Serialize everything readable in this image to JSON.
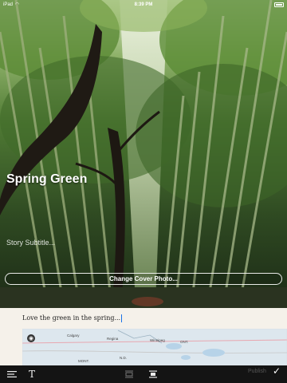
{
  "status_bar": {
    "carrier": "iPad",
    "time": "8:39 PM"
  },
  "story": {
    "title": "Spring Green",
    "subtitle_placeholder": "Story Subtitle...",
    "change_cover_label": "Change Cover Photo...",
    "body_text": "Love the green in the spring..."
  },
  "map": {
    "labels": [
      "Calgary",
      "Regina",
      "Winnipeg",
      "ONT.",
      "MONT.",
      "N.D."
    ]
  },
  "toolbar": {
    "text_label": "T",
    "publish_label": "Publish",
    "check_label": "✓"
  },
  "colors": {
    "toolbar_bg": "#141414",
    "editor_bg": "#f5f1ea",
    "cursor": "#1a73e8"
  }
}
